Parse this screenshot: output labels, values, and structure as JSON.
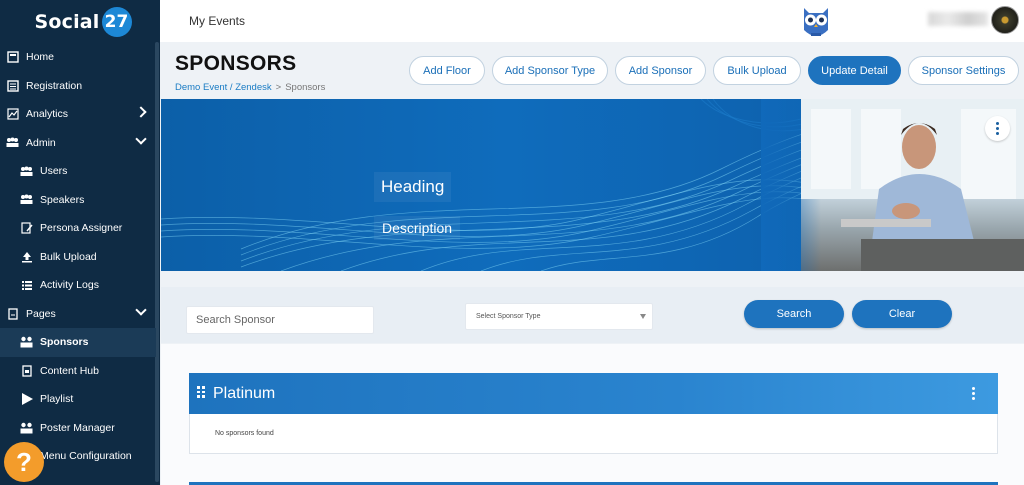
{
  "brand": {
    "name": "Social",
    "badge": "27"
  },
  "topbar": {
    "title": "My Events"
  },
  "sidebar": {
    "items": [
      {
        "label": "Home",
        "icon": "home-icon"
      },
      {
        "label": "Registration",
        "icon": "registration-icon"
      },
      {
        "label": "Analytics",
        "icon": "analytics-icon"
      },
      {
        "label": "Admin",
        "icon": "admin-icon"
      },
      {
        "label": "Users",
        "icon": "users-icon"
      },
      {
        "label": "Speakers",
        "icon": "speakers-icon"
      },
      {
        "label": "Persona Assigner",
        "icon": "persona-icon"
      },
      {
        "label": "Bulk Upload",
        "icon": "upload-icon"
      },
      {
        "label": "Activity Logs",
        "icon": "list-icon"
      },
      {
        "label": "Pages",
        "icon": "pages-icon"
      },
      {
        "label": "Sponsors",
        "icon": "sponsors-icon"
      },
      {
        "label": "Content Hub",
        "icon": "content-hub-icon"
      },
      {
        "label": "Playlist",
        "icon": "play-icon"
      },
      {
        "label": "Poster Manager",
        "icon": "poster-icon"
      },
      {
        "label": "Menu Configuration",
        "icon": "menu-config-icon"
      }
    ],
    "help_label": "?"
  },
  "page": {
    "title": "SPONSORS",
    "breadcrumb": {
      "link": "Demo Event / Zendesk",
      "separator": ">",
      "current": "Sponsors"
    }
  },
  "actions": {
    "add_floor": "Add Floor",
    "add_sponsor_type": "Add Sponsor Type",
    "add_sponsor": "Add Sponsor",
    "bulk_upload": "Bulk Upload",
    "update_detail": "Update Detail",
    "sponsor_settings": "Sponsor Settings"
  },
  "banner": {
    "heading": "Heading",
    "description": "Description"
  },
  "search": {
    "placeholder": "Search Sponsor",
    "select_placeholder": "Select Sponsor Type",
    "search_label": "Search",
    "clear_label": "Clear"
  },
  "sections": [
    {
      "title": "Platinum",
      "empty_text": "No sponsors found"
    }
  ],
  "colors": {
    "sidebar": "#0f2b44",
    "accent": "#1e73be",
    "help": "#f39c2b"
  }
}
